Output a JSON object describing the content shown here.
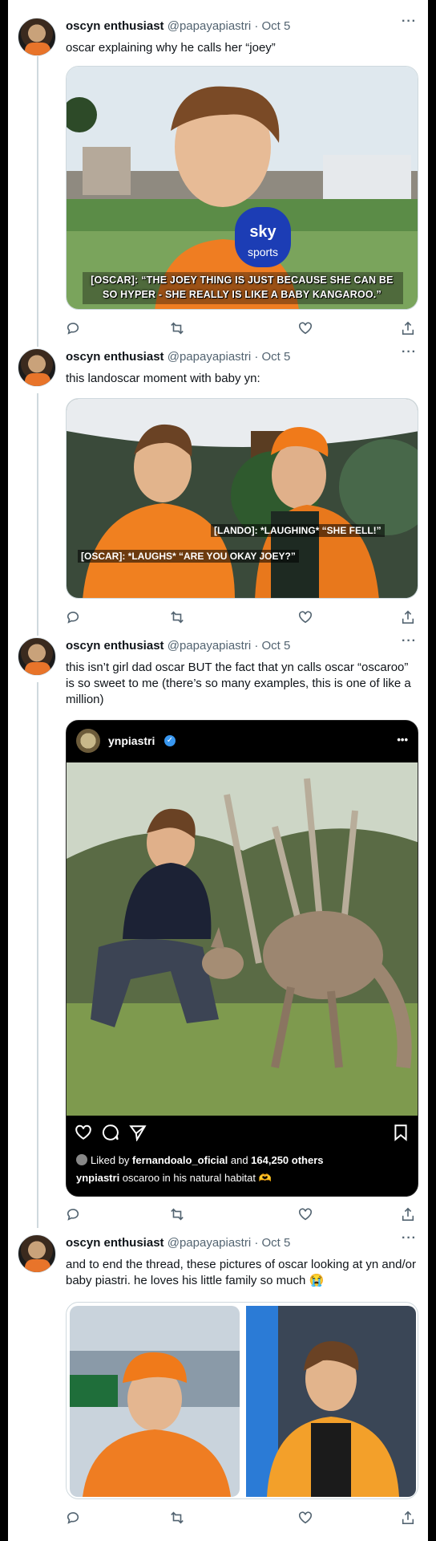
{
  "tweets": [
    {
      "author_name": "oscyn enthusiast",
      "handle_time": "@papayapiastri · Oct 5",
      "text": "oscar explaining why he calls her “joey”",
      "media": {
        "mic_brand": "sky sports",
        "caption_line1": "[OSCAR]: “THE JOEY THING IS JUST BECAUSE SHE CAN BE",
        "caption_line2": "SO HYPER - SHE REALLY IS LIKE A BABY KANGAROO.”"
      }
    },
    {
      "author_name": "oscyn enthusiast",
      "handle_time": "@papayapiastri · Oct 5",
      "text": "this landoscar moment with baby yn:",
      "media": {
        "caption_lando": "[LANDO]: *LAUGHING* “SHE FELL!”",
        "caption_oscar": "[OSCAR]: *LAUGHS* “ARE YOU OKAY JOEY?”"
      }
    },
    {
      "author_name": "oscyn enthusiast",
      "handle_time": "@papayapiastri · Oct 5",
      "text": "this isn’t girl dad oscar BUT the fact that yn calls oscar “oscaroo” is so sweet to me (there’s so many examples, this is one of like a million)",
      "media": {
        "ig_username": "ynpiastri",
        "ig_more": "•••",
        "liked_by_prefix": "Liked by ",
        "liked_by_user": "fernandoalo_oficial",
        "liked_by_mid": " and ",
        "liked_by_count": "164,250 others",
        "caption_user": "ynpiastri",
        "caption_text": " oscaroo in his natural habitat 🫶"
      }
    },
    {
      "author_name": "oscyn enthusiast",
      "handle_time": "@papayapiastri · Oct 5",
      "text": "and to end the thread, these pictures of oscar looking at yn and/or baby piastri. he loves his little family so much 😭",
      "media": {}
    }
  ],
  "ui": {
    "more_label": "···",
    "icons": [
      "reply-icon",
      "retweet-icon",
      "like-icon",
      "share-icon"
    ]
  }
}
